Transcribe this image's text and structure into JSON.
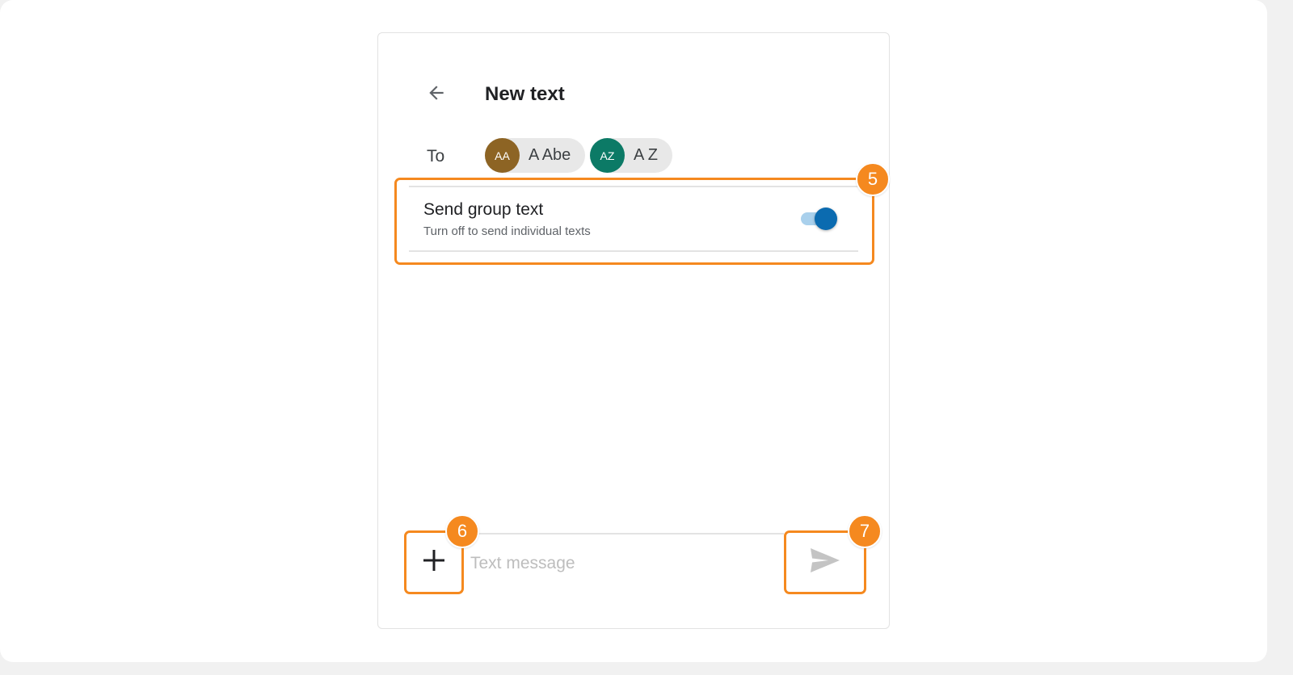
{
  "header": {
    "back_icon": "arrow-back-icon",
    "title": "New text"
  },
  "recipients": {
    "label": "To",
    "chips": [
      {
        "initials": "AA",
        "name": "A Abe",
        "color": "#8d6424"
      },
      {
        "initials": "AZ",
        "name": "A Z",
        "color": "#0c7a66"
      }
    ]
  },
  "group_setting": {
    "title": "Send group text",
    "subtitle": "Turn off to send individual texts",
    "enabled": true,
    "toggle_color": "#0b6bb0"
  },
  "composer": {
    "add_icon": "plus-icon",
    "placeholder": "Text message",
    "value": "",
    "send_icon": "send-icon"
  },
  "annotations": {
    "accent_color": "#f5891f",
    "labels": [
      "5",
      "6",
      "7"
    ]
  }
}
